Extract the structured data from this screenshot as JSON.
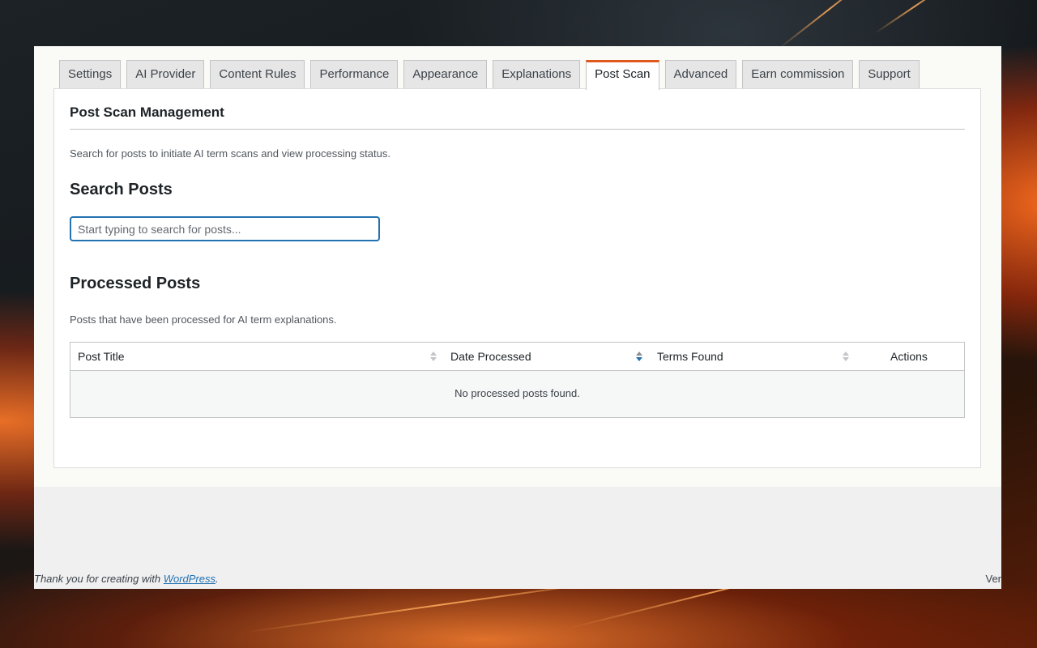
{
  "tabs": [
    {
      "label": "Settings",
      "active": false
    },
    {
      "label": "AI Provider",
      "active": false
    },
    {
      "label": "Content Rules",
      "active": false
    },
    {
      "label": "Performance",
      "active": false
    },
    {
      "label": "Appearance",
      "active": false
    },
    {
      "label": "Explanations",
      "active": false
    },
    {
      "label": "Post Scan",
      "active": true
    },
    {
      "label": "Advanced",
      "active": false
    },
    {
      "label": "Earn commission",
      "active": false
    },
    {
      "label": "Support",
      "active": false
    }
  ],
  "panel": {
    "title": "Post Scan Management",
    "description": "Search for posts to initiate AI term scans and view processing status."
  },
  "search": {
    "heading": "Search Posts",
    "placeholder": "Start typing to search for posts...",
    "value": ""
  },
  "processed": {
    "heading": "Processed Posts",
    "description": "Posts that have been processed for AI term explanations.",
    "columns": [
      "Post Title",
      "Date Processed",
      "Terms Found",
      "Actions"
    ],
    "empty_message": "No processed posts found."
  },
  "footer": {
    "text_prefix": "Thank you for creating with ",
    "link_text": "WordPress",
    "text_suffix": ".",
    "version_text": "Ver"
  },
  "colors": {
    "accent": "#e0581c",
    "link": "#2271b1"
  }
}
